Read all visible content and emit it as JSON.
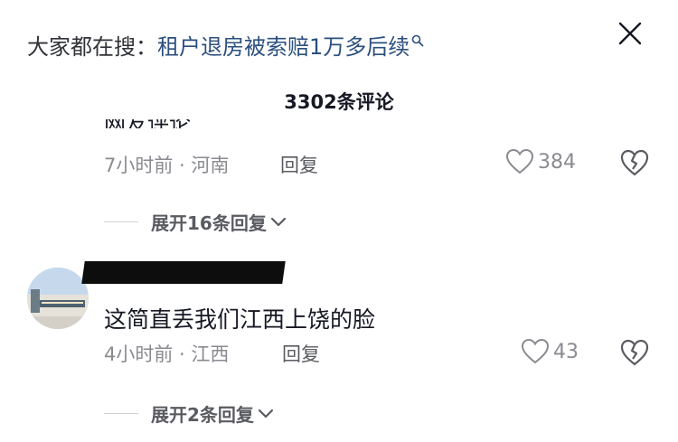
{
  "search_hint": {
    "prefix": "大家都在搜：",
    "query": "租户退房被索赔1万多后续"
  },
  "header": {
    "title": "3302条评论"
  },
  "comments": [
    {
      "text_clipped": "网友评论",
      "time": "7小时前 · 河南",
      "reply_label": "回复",
      "likes": "384",
      "expand_label": "展开16条回复"
    },
    {
      "text": "这简直丢我们江西上饶的脸",
      "time": "4小时前 · 江西",
      "reply_label": "回复",
      "likes": "43",
      "expand_label": "展开2条回复"
    }
  ],
  "icons": {
    "search": "search-icon",
    "close": "close-icon",
    "like": "heart-icon",
    "dislike": "broken-heart-icon",
    "chevron": "chevron-down-icon"
  }
}
